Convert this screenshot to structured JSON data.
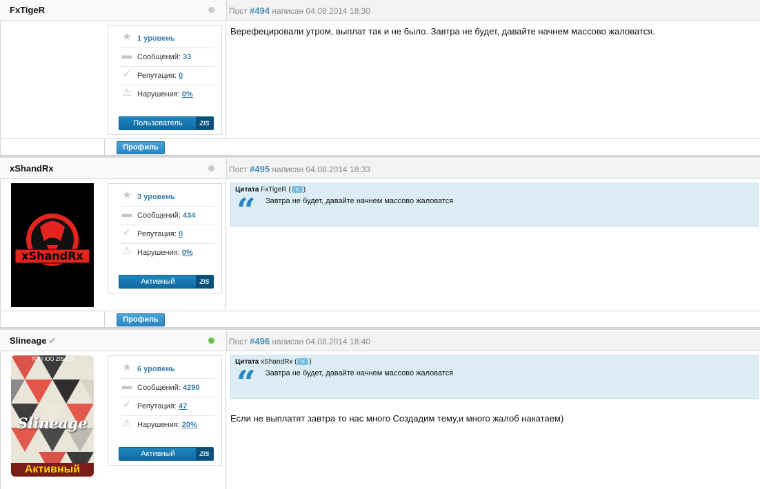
{
  "posts": [
    {
      "author": "FxTigeR",
      "verified": false,
      "online": false,
      "meta_prefix": "Пост",
      "number": "#494",
      "meta_suffix": "написан 04.08.2014 18:30",
      "level": "1 уровень",
      "messages_label": "Сообщений:",
      "messages": "33",
      "reputation_label": "Репутация:",
      "reputation": "0",
      "violations_label": "Нарушения:",
      "violations": "0%",
      "group": "Пользователь",
      "group_tag": "ZIS",
      "quote": null,
      "text": "Верефецировали утром, выплат так и не было. Завтра не будет, давайте начнем массово жаловатся.",
      "profile_label": "Профиль"
    },
    {
      "author": "xShandRx",
      "verified": false,
      "online": false,
      "meta_prefix": "Пост",
      "number": "#495",
      "meta_suffix": "написан 04.08.2014 18:33",
      "level": "3 уровень",
      "messages_label": "Сообщений:",
      "messages": "434",
      "reputation_label": "Репутация:",
      "reputation": "0",
      "violations_label": "Нарушения:",
      "violations": "0%",
      "group": "Активный",
      "group_tag": "ZIS",
      "avatar_text": "xShandRx",
      "quote": {
        "label": "Цитата",
        "author": "FxTigeR",
        "text": "Завтра не будет, давайте начнем массово жаловатся"
      },
      "text": "",
      "profile_label": "Профиль"
    },
    {
      "author": "Slineage",
      "verified": true,
      "online": true,
      "meta_prefix": "Пост",
      "number": "#496",
      "meta_suffix": "написан 04.08.2014 18:40",
      "level": "6 уровень",
      "messages_label": "Сообщений:",
      "messages": "4290",
      "reputation_label": "Репутация:",
      "reputation": "47",
      "violations_label": "Нарушения:",
      "violations": "20%",
      "group": "Активный",
      "group_tag": "ZIS",
      "avatar_top": "ТОП ЮО ZIS/7.0",
      "avatar_name": "Slineage",
      "avatar_bottom": "Активный",
      "quote": {
        "label": "Цитата",
        "author": "xShandRx",
        "text": "Завтра не будет, давайте начнем массово жаловатся"
      },
      "text": "Если не выплатят завтра то нас много Создадим тему,и много жалоб накатаем)"
    }
  ],
  "colors": {
    "accent": "#2a86c0",
    "online": "#6cc04a",
    "offline": "#c8c8c8",
    "quote_bg": "#dcedf5"
  },
  "icons": {
    "level": "star-icon",
    "messages": "speech-bubble-icon",
    "reputation": "checkmark-icon",
    "violations": "warning-icon",
    "quote": "quote-mark-icon"
  }
}
